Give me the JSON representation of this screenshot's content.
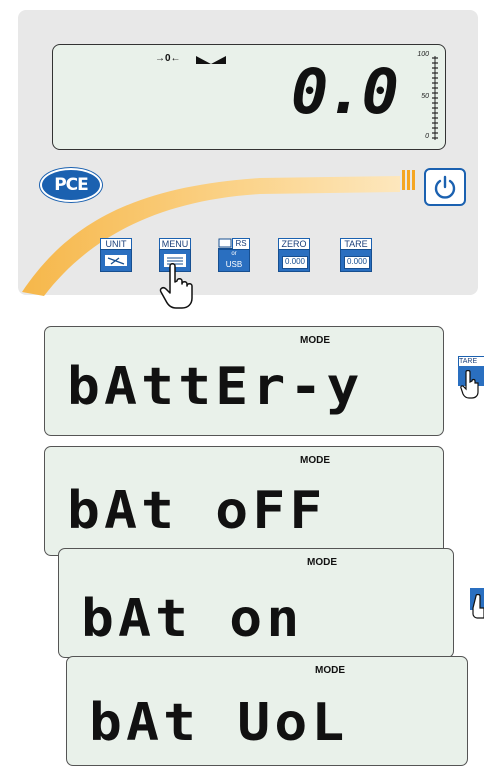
{
  "main_display": {
    "zero_indicator": "→0←",
    "weight": "0.0",
    "bar_top": "100",
    "bar_mid": "50",
    "bar_bottom": "0"
  },
  "logo": {
    "text": "PCE"
  },
  "keys": {
    "unit": "UNIT",
    "menu": "MENU",
    "rs": "RS",
    "rs_or": "or",
    "usb": "USB",
    "zero": "ZERO",
    "zero_value": "0.000",
    "tare": "TARE",
    "tare_value": "0.000"
  },
  "steps": [
    {
      "mode": "MODE",
      "segments": "bAttEr-y"
    },
    {
      "mode": "MODE",
      "segments": "bAt  oFF"
    },
    {
      "mode": "MODE",
      "segments": "bAt    on"
    },
    {
      "mode": "MODE",
      "segments": "bAt  UoL"
    }
  ],
  "side_key": {
    "label": "TARE"
  },
  "colors": {
    "brand_blue": "#1b61b0",
    "accent_orange": "#f5a623",
    "lcd_bg": "#e9f1ea"
  },
  "icons": [
    "hand-pointer-icon",
    "power-icon",
    "stable-icon",
    "unit-arrows-icon",
    "menu-list-icon",
    "computer-icon"
  ]
}
